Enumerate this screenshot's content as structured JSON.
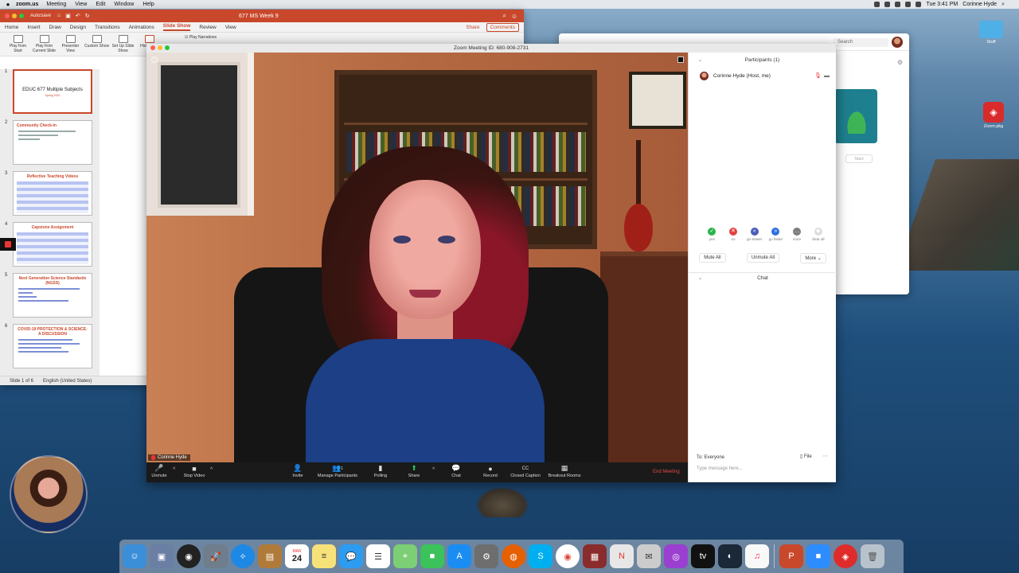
{
  "menubar": {
    "app_name": "zoom.us",
    "menus": [
      "Meeting",
      "View",
      "Edit",
      "Window",
      "Help"
    ],
    "clock": "Tue 3:41 PM",
    "user": "Corinne Hyde"
  },
  "powerpoint": {
    "autosave_label": "AutoSave",
    "file_name": "677 MS Week 9",
    "tabs": [
      "Home",
      "Insert",
      "Draw",
      "Design",
      "Transitions",
      "Animations",
      "Slide Show",
      "Review",
      "View"
    ],
    "active_tab": "Slide Show",
    "share_label": "Share",
    "comments_label": "Comments",
    "ribbon": [
      {
        "label": "Play from Start",
        "icon": "play-icon"
      },
      {
        "label": "Play from Current Slide",
        "icon": "play-current-icon"
      },
      {
        "label": "Presenter View",
        "icon": "presenter-icon"
      },
      {
        "label": "Custom Show",
        "icon": "custom-show-icon"
      },
      {
        "label": "Set Up Slide Show",
        "icon": "setup-icon"
      },
      {
        "label": "Hide Slide",
        "icon": "hide-slide-icon"
      }
    ],
    "ribbon_checkbox": "Play Narrations",
    "slides": [
      {
        "num": "1",
        "title": "EDUC 677 Multiple Subjects",
        "subtitle": "Spring 2020",
        "selected": true
      },
      {
        "num": "2",
        "title": "Community Check-In",
        "style": "lines"
      },
      {
        "num": "3",
        "title": "Reflective Teaching Videos",
        "style": "table"
      },
      {
        "num": "4",
        "title": "Capstone Assignment",
        "style": "table"
      },
      {
        "num": "5",
        "title": "Next Generation Science Standards (NGSS)",
        "style": "lines-blue"
      },
      {
        "num": "6",
        "title": "COVID-19 PROTECTION & SCIENCE: A DISCUSSION",
        "style": "lines-blue"
      }
    ],
    "status_slide": "Slide 1 of 6",
    "status_lang": "English (United States)"
  },
  "zoom_home": {
    "search_placeholder": "Search",
    "start_label": "Start"
  },
  "meeting": {
    "title": "Zoom Meeting ID: 680-908-2731",
    "speaker_name": "Corinne Hyde",
    "toolbar": [
      {
        "label": "Unmute",
        "icon": "mic-muted-icon",
        "glyph": "🎤",
        "red": true
      },
      {
        "label": "Stop Video",
        "icon": "video-camera-icon",
        "glyph": "■"
      },
      {
        "label": "Invite",
        "icon": "invite-icon",
        "glyph": "👤"
      },
      {
        "label": "Manage Participants",
        "icon": "participants-icon",
        "glyph": "👥",
        "badge": "1"
      },
      {
        "label": "Polling",
        "icon": "polling-icon",
        "glyph": "▮"
      },
      {
        "label": "Share",
        "icon": "share-screen-icon",
        "glyph": "⬆",
        "green": true
      },
      {
        "label": "Chat",
        "icon": "chat-icon",
        "glyph": "💬"
      },
      {
        "label": "Record",
        "icon": "record-icon",
        "glyph": "●"
      },
      {
        "label": "Closed Caption",
        "icon": "cc-icon",
        "glyph": "CC"
      },
      {
        "label": "Breakout Rooms",
        "icon": "breakout-icon",
        "glyph": "▦"
      }
    ],
    "end_label": "End Meeting"
  },
  "participants": {
    "title": "Participants (1)",
    "list": [
      {
        "name": "Corinne Hyde (Host, me)"
      }
    ],
    "feedback": [
      {
        "label": "yes",
        "glyph": "✓",
        "color": "green"
      },
      {
        "label": "no",
        "glyph": "✕",
        "color": "red"
      },
      {
        "label": "go slower",
        "glyph": "«",
        "color": "blue1"
      },
      {
        "label": "go faster",
        "glyph": "»",
        "color": "blue2"
      },
      {
        "label": "more",
        "glyph": "…",
        "color": "gray"
      },
      {
        "label": "clear all",
        "glyph": "◆",
        "color": "light"
      }
    ],
    "mute_all": "Mute All",
    "unmute_all": "Unmute All",
    "more": "More"
  },
  "chat": {
    "title": "Chat",
    "to_label": "To: Everyone",
    "file_label": "File",
    "input_placeholder": "Type message here..."
  },
  "desktop": {
    "folder_label": "Stuff",
    "zoom_installer_label": "Zoom.pkg"
  },
  "dock": {
    "calendar_month": "MAR",
    "calendar_day": "24"
  }
}
